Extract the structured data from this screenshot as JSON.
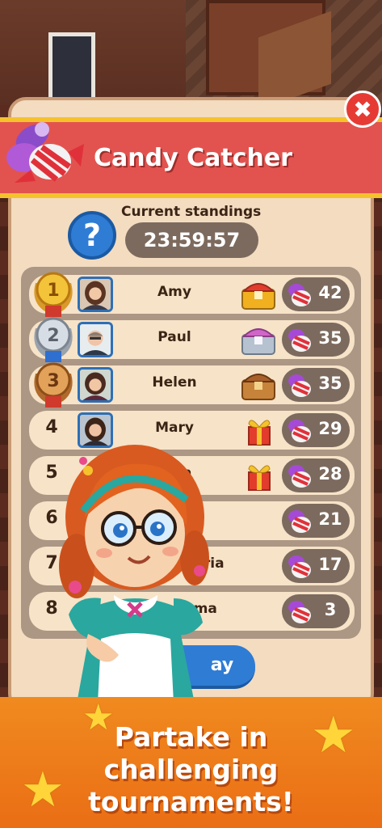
{
  "dialog": {
    "title": "Candy Catcher",
    "close_icon": "close-icon",
    "standings_label": "Current standings",
    "timer": "23:59:57",
    "help_label": "?"
  },
  "leaderboard": [
    {
      "rank": "1",
      "name": "Amy",
      "score": "42",
      "reward": "red-chest-icon",
      "medal": "gold"
    },
    {
      "rank": "2",
      "name": "Paul",
      "score": "35",
      "reward": "purple-chest-icon",
      "medal": "silver"
    },
    {
      "rank": "3",
      "name": "Helen",
      "score": "35",
      "reward": "brown-chest-icon",
      "medal": "bronze"
    },
    {
      "rank": "4",
      "name": "Mary",
      "score": "29",
      "reward": "gift-box-icon"
    },
    {
      "rank": "5",
      "name": "a",
      "score": "28",
      "reward": "gift-box-icon"
    },
    {
      "rank": "6",
      "name": "ty",
      "score": "21"
    },
    {
      "rank": "7",
      "name": "ctoria",
      "score": "17"
    },
    {
      "rank": "8",
      "name": "mma",
      "score": "3"
    }
  ],
  "play_button": "ay",
  "banner": {
    "line1": "Partake in",
    "line2": "challenging",
    "line3": "tournaments!"
  },
  "colors": {
    "ribbon": "#e2534f",
    "panel": "#f3dcc0",
    "button_blue": "#2f7cd4",
    "banner_orange": "#f08a1f"
  }
}
